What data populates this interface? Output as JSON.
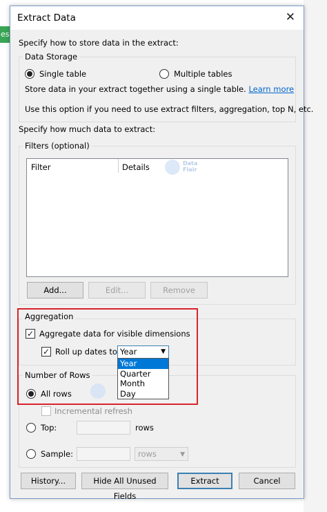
{
  "background": {
    "tab_fragment": "es"
  },
  "dialog": {
    "title": "Extract Data"
  },
  "storage": {
    "intro": "Specify how to store data in the extract:",
    "group_label": "Data Storage",
    "single_label": "Single table",
    "multiple_label": "Multiple tables",
    "desc": "Store data in your extract together using a single table.",
    "learn_more": "Learn more",
    "note": "Use this option if you need to use extract filters, aggregation, top N, etc."
  },
  "amount": {
    "intro": "Specify how much data to extract:",
    "filters_label": "Filters (optional)",
    "columns": [
      "Filter",
      "Details"
    ],
    "add_label": "Add...",
    "edit_label": "Edit...",
    "remove_label": "Remove"
  },
  "aggregation": {
    "group_label": "Aggregation",
    "aggregate_label": "Aggregate data for visible dimensions",
    "rollup_label": "Roll up dates to",
    "rollup_value": "Year",
    "rollup_options": [
      "Year",
      "Quarter",
      "Month",
      "Day"
    ]
  },
  "rows": {
    "group_label": "Number of Rows",
    "all_label": "All rows",
    "incremental_label": "Incremental refresh",
    "top_label": "Top:",
    "top_unit": "rows",
    "sample_label": "Sample:",
    "sample_unit": "rows"
  },
  "watermark": {
    "line1": "Data",
    "line2": "Flair"
  },
  "footer": {
    "history_label": "History...",
    "hide_label": "Hide All Unused Fields",
    "extract_label": "Extract",
    "cancel_label": "Cancel"
  },
  "colors": {
    "accent": "#0078d7",
    "highlight": "#d9222a",
    "link": "#0066cc"
  }
}
